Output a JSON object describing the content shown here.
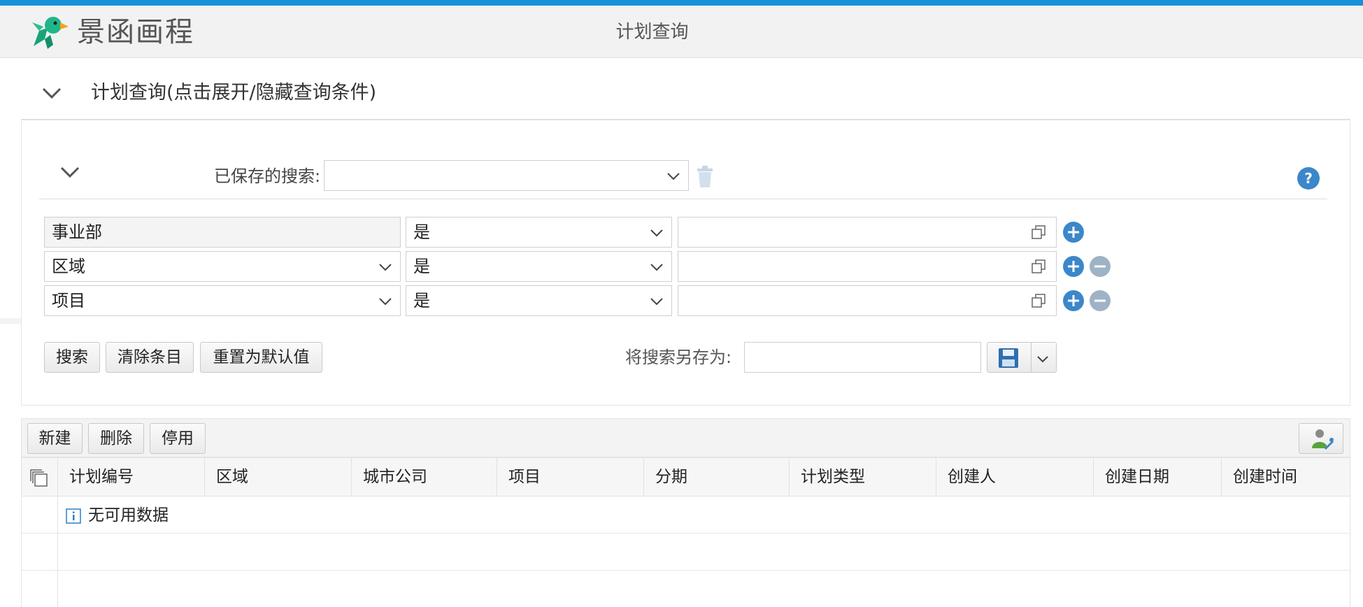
{
  "header": {
    "logo_text": "景函画程",
    "page_title": "计划查询"
  },
  "section": {
    "title": "计划查询(点击展开/隐藏查询条件)"
  },
  "saved_search": {
    "label": "已保存的搜索:",
    "value": ""
  },
  "conditions": [
    {
      "field": "事业部",
      "operator": "是",
      "value": "",
      "removable": false
    },
    {
      "field": "区域",
      "operator": "是",
      "value": "",
      "removable": true
    },
    {
      "field": "项目",
      "operator": "是",
      "value": "",
      "removable": true
    }
  ],
  "actions": {
    "search": "搜索",
    "clear": "清除条目",
    "reset": "重置为默认值",
    "save_as_label": "将搜索另存为:",
    "save_as_value": ""
  },
  "toolbar": {
    "new": "新建",
    "delete": "删除",
    "disable": "停用"
  },
  "grid": {
    "columns": [
      "计划编号",
      "区域",
      "城市公司",
      "项目",
      "分期",
      "计划类型",
      "创建人",
      "创建日期",
      "创建时间"
    ],
    "empty_text": "无可用数据"
  },
  "colors": {
    "accent": "#1890d8",
    "round_button": "#3b87c9"
  }
}
